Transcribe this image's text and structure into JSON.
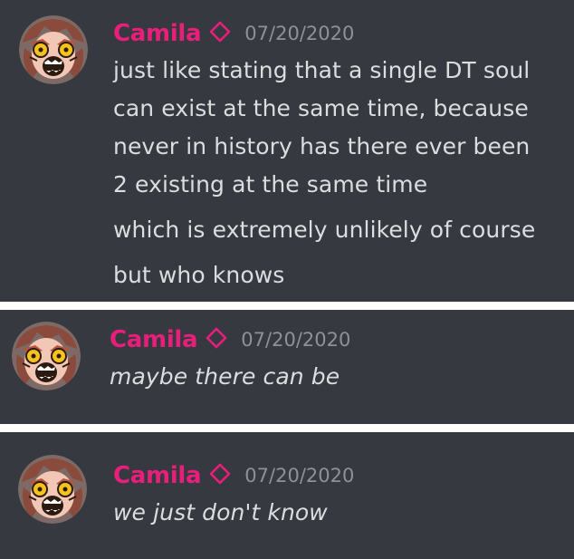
{
  "messages": [
    {
      "username": "Camila",
      "timestamp": "07/20/2020",
      "lines": [
        "just like stating that a single DT soul",
        "can exist at the same time, because",
        "never in history has there ever been",
        "2 existing at the same time",
        "which is extremely unlikely of course",
        "but who knows"
      ]
    },
    {
      "username": "Camila",
      "timestamp": "07/20/2020",
      "lines": [
        "maybe there can be"
      ]
    },
    {
      "username": "Camila",
      "timestamp": "07/20/2020",
      "lines": [
        "we just don't know"
      ]
    }
  ],
  "colors": {
    "background": "#36393f",
    "username": "#e91e7a",
    "timestamp": "#8e9297",
    "message_text": "#dcddde",
    "separator": "#ffffff"
  },
  "icons": {
    "avatar": "screaming-anime-girl-avatar",
    "role": "diamond-outline-icon"
  }
}
